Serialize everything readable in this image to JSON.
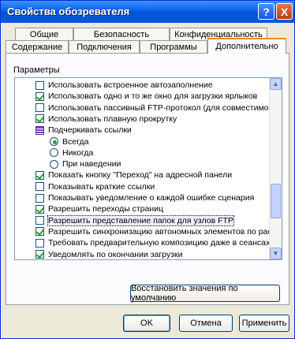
{
  "window": {
    "title": "Свойства обозревателя"
  },
  "tabs_row1": [
    "Общие",
    "Безопасность",
    "Конфиденциальность"
  ],
  "tabs_row2": [
    "Содержание",
    "Подключения",
    "Программы",
    "Дополнительно"
  ],
  "panel": {
    "params_label": "Параметры"
  },
  "settings": [
    {
      "type": "checkbox",
      "checked": false,
      "label": "Использовать встроенное автозаполнение"
    },
    {
      "type": "checkbox",
      "checked": true,
      "label": "Использовать одно и то же окно для загрузки ярлыков"
    },
    {
      "type": "checkbox",
      "checked": false,
      "label": "Использовать пассивный FTP-протокол (для совместимост"
    },
    {
      "type": "checkbox",
      "checked": true,
      "label": "Использовать плавную прокрутку"
    },
    {
      "type": "group",
      "checked": false,
      "label": "Подчеркивать ссылки"
    },
    {
      "type": "radio",
      "checked": true,
      "label": "Всегда"
    },
    {
      "type": "radio",
      "checked": false,
      "label": "Никогда"
    },
    {
      "type": "radio",
      "checked": false,
      "label": "При наведении"
    },
    {
      "type": "checkbox",
      "checked": true,
      "label": "Показать кнопку \"Переход\" на адресной панели"
    },
    {
      "type": "checkbox",
      "checked": false,
      "label": "Показывать краткие ссылки"
    },
    {
      "type": "checkbox",
      "checked": false,
      "label": "Показывать уведомление о каждой ошибке сценария"
    },
    {
      "type": "checkbox",
      "checked": true,
      "label": "Разрешить переходы страниц"
    },
    {
      "type": "checkbox",
      "checked": false,
      "label": "Разрешить представление папок для узлов FTP",
      "selected": true
    },
    {
      "type": "checkbox",
      "checked": true,
      "label": "Разрешить синхронизацию автономных элементов по расп"
    },
    {
      "type": "checkbox",
      "checked": false,
      "label": "Требовать предварительную композицию даже в сеансах с"
    },
    {
      "type": "checkbox",
      "checked": true,
      "label": "Уведомлять по окончании загрузки"
    }
  ],
  "buttons": {
    "restore_defaults": "Восстановить значения по умолчанию",
    "ok": "OK",
    "cancel": "Отмена",
    "apply": "Применить"
  },
  "titlebar_buttons": {
    "help": "?",
    "close": "X"
  }
}
